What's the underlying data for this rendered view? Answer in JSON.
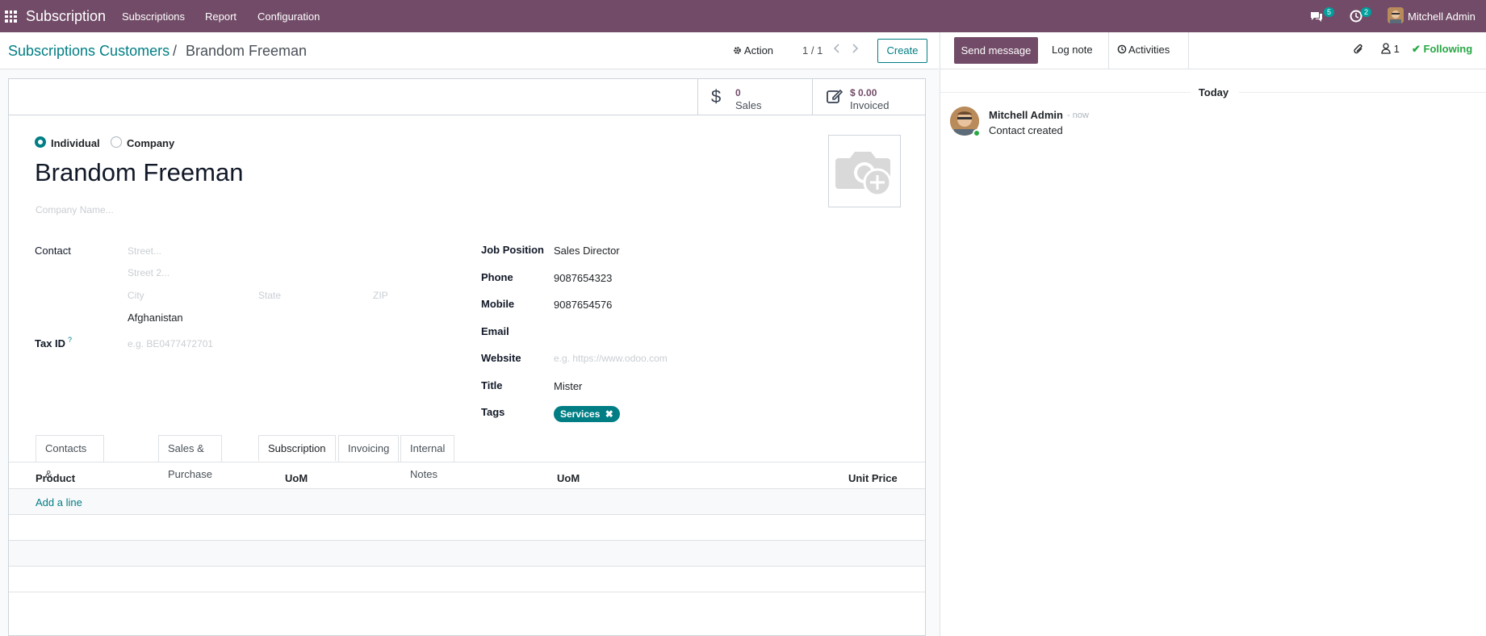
{
  "navbar": {
    "brand": "Subscription",
    "menus": [
      "Subscriptions",
      "Report",
      "Configuration"
    ],
    "messages_count": "5",
    "activities_count": "2",
    "user": "Mitchell Admin"
  },
  "breadcrumb": {
    "parent": "Subscriptions Customers",
    "separator": "/",
    "current": "Brandom Freeman"
  },
  "control": {
    "action_label": "Action",
    "pager": "1 / 1",
    "create_label": "Create"
  },
  "stats": {
    "sales_value": "0",
    "sales_label": "Sales",
    "invoiced_value": "$ 0.00",
    "invoiced_label": "Invoiced"
  },
  "form": {
    "type_individual": "Individual",
    "type_company": "Company",
    "name": "Brandom Freeman",
    "company_placeholder": "Company Name...",
    "contact_label": "Contact",
    "street_placeholder": "Street...",
    "street2_placeholder": "Street 2...",
    "city_placeholder": "City",
    "state_placeholder": "State",
    "zip_placeholder": "ZIP",
    "country": "Afghanistan",
    "taxid_label": "Tax ID",
    "taxid_help": "?",
    "taxid_placeholder": "e.g. BE0477472701",
    "job_label": "Job Position",
    "job_value": "Sales Director",
    "phone_label": "Phone",
    "phone_value": "9087654323",
    "mobile_label": "Mobile",
    "mobile_value": "9087654576",
    "email_label": "Email",
    "website_label": "Website",
    "website_placeholder": "e.g. https://www.odoo.com",
    "title_label": "Title",
    "title_value": "Mister",
    "tags_label": "Tags",
    "tag": "Services"
  },
  "tabs": [
    "Contacts & Addresses",
    "Sales & Purchase",
    "Subscription",
    "Invoicing",
    "Internal Notes"
  ],
  "table": {
    "headers": [
      "Product",
      "UoM",
      "UoM",
      "Unit Price"
    ],
    "add_line": "Add a line"
  },
  "chatter": {
    "send_message": "Send message",
    "log_note": "Log note",
    "activities": "Activities",
    "followers_count": "1",
    "following": "Following",
    "day": "Today",
    "author": "Mitchell Admin",
    "time": "- now",
    "message": "Contact created"
  },
  "colors": {
    "brand": "#714b67",
    "accent": "#017e84",
    "following": "#28a745"
  }
}
